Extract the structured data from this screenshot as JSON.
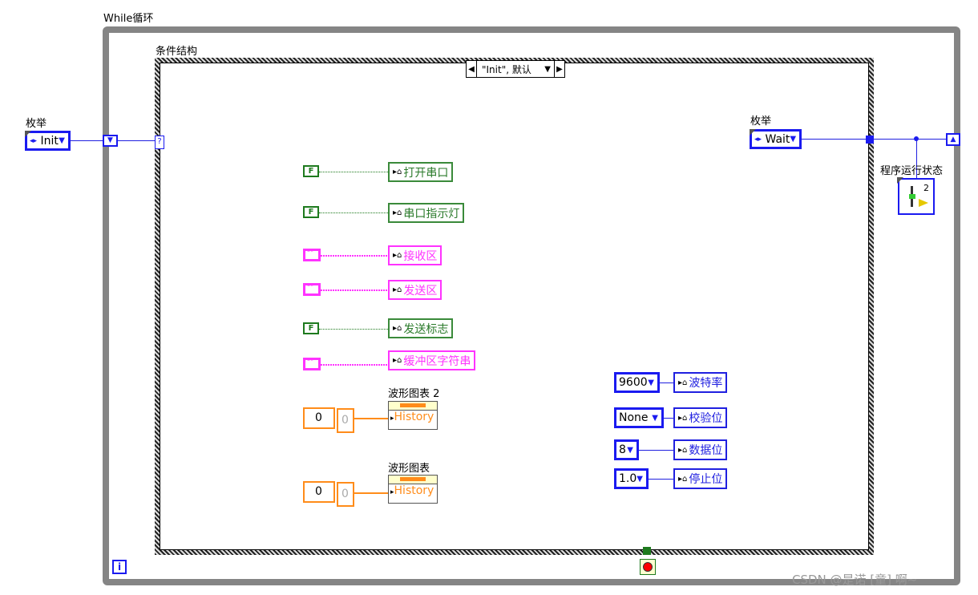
{
  "while_loop": {
    "label": "While循环",
    "iteration_terminal": "i"
  },
  "case_structure": {
    "label": "条件结构",
    "selector_value": "\"Init\", 默认",
    "selector_terminal": "?"
  },
  "input_enum": {
    "label": "枚举",
    "value": "Init"
  },
  "output_enum": {
    "label": "枚举",
    "value": "Wait"
  },
  "status_indicator": {
    "label": "程序运行状态",
    "value": "2"
  },
  "bool_locals": [
    {
      "constant": "F",
      "name": "打开串口"
    },
    {
      "constant": "F",
      "name": "串口指示灯"
    },
    {
      "constant": "F",
      "name": "发送标志"
    }
  ],
  "string_locals": [
    {
      "constant": "“”",
      "name": "接收区"
    },
    {
      "constant": "“”",
      "name": "发送区"
    },
    {
      "constant": "“”",
      "name": "缓冲区字符串"
    }
  ],
  "charts": [
    {
      "label": "波形图表 2",
      "control_value": "0",
      "indicator_value": "0",
      "property": "History"
    },
    {
      "label": "波形图表",
      "control_value": "0",
      "indicator_value": "0",
      "property": "History"
    }
  ],
  "serial_settings": [
    {
      "value": "9600",
      "name": "波特率"
    },
    {
      "value": "None",
      "name": "校验位"
    },
    {
      "value": "8",
      "name": "数据位"
    },
    {
      "value": "1.0",
      "name": "停止位"
    }
  ],
  "watermark": "CSDN @是诺 [童] 啊~",
  "colors": {
    "enum_wire": "#2020e0",
    "boolean": "#1e7a1e",
    "string": "#ff33ff",
    "numeric": "#ff8c1a",
    "loop_frame": "#858585"
  }
}
